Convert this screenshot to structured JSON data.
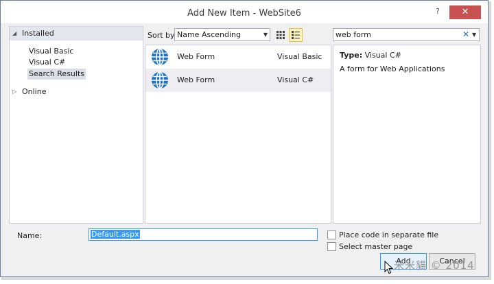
{
  "window": {
    "title": "Add New Item - WebSite6",
    "help_glyph": "?",
    "close_glyph": "✕"
  },
  "sidebar": {
    "installed": "Installed",
    "children": [
      "Visual Basic",
      "Visual C#",
      "Search Results"
    ],
    "selected_child": "Search Results",
    "online": "Online"
  },
  "toolbar": {
    "sort_label": "Sort by:",
    "sort_value": "Name Ascending",
    "active_view": "list"
  },
  "search": {
    "value": "web form",
    "clear_glyph": "✕"
  },
  "items": [
    {
      "name": "Web Form",
      "language": "Visual Basic",
      "icon": "globe-icon"
    },
    {
      "name": "Web Form",
      "language": "Visual C#",
      "icon": "globe-icon",
      "selected": true
    }
  ],
  "details": {
    "type_label": "Type:",
    "type_value": "Visual C#",
    "description": "A form for Web Applications"
  },
  "footer": {
    "name_label": "Name:",
    "name_value": "Default.aspx",
    "checkbox_separate": "Place code in separate file",
    "checkbox_master": "Select master page",
    "add_label": "Add",
    "cancel_label": "Cancel"
  },
  "watermark": "米米貓 © 2014",
  "colors": {
    "accent": "#3399ff",
    "close": "#c75050",
    "globe": "#1e72c6"
  }
}
